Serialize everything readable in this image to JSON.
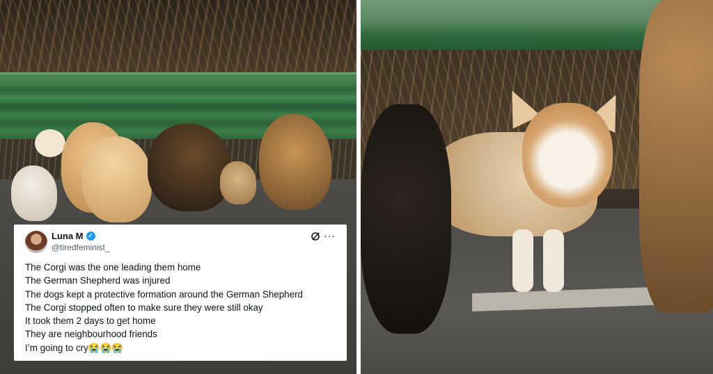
{
  "tweet": {
    "author_name": "Luna M",
    "handle": "@tiredfeminist_",
    "lines": [
      "The Corgi was the one leading them home",
      "The German Shepherd was injured",
      "The dogs kept a protective formation around the German Shepherd",
      "The Corgi stopped often to make sure they were still okay",
      "It took them 2 days to get home",
      "They are neighbourhood friends",
      "I’m going to cry😭😭😭"
    ]
  },
  "colors": {
    "verified_badge": "#1d9bf0",
    "text_primary": "#0f1419",
    "text_secondary": "#536471"
  },
  "icons": {
    "verified": "verified-checkmark-icon",
    "grok": "grok-icon",
    "more": "more-options-icon"
  }
}
